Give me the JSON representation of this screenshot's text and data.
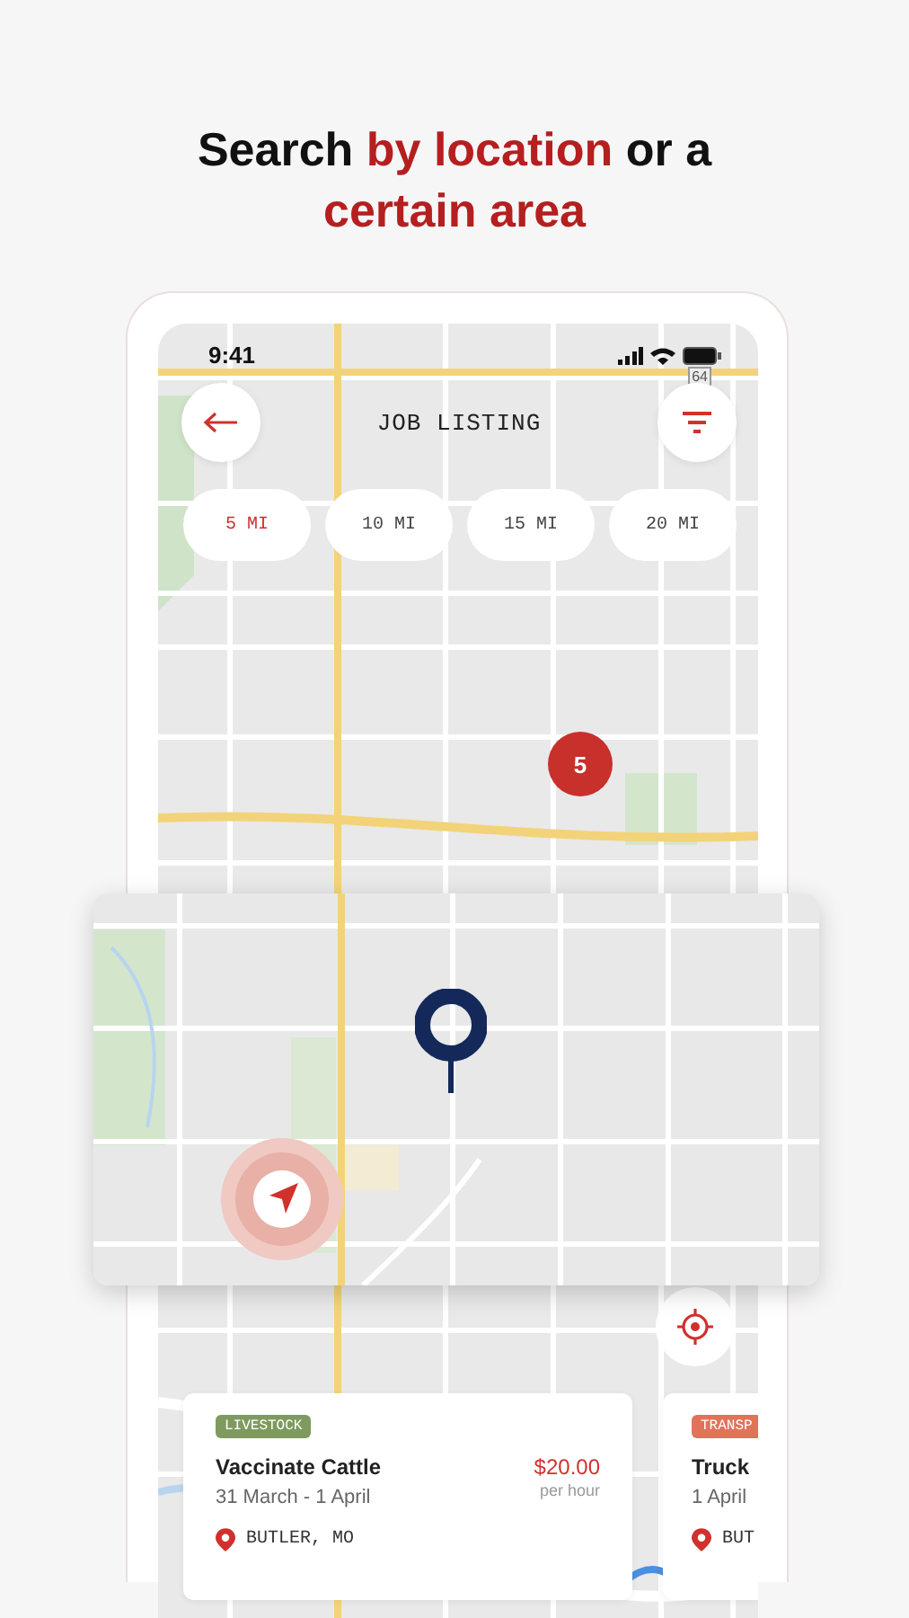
{
  "headline": {
    "lines": [
      [
        {
          "text": "Search ",
          "highlight": false
        },
        {
          "text": "by location",
          "highlight": true
        },
        {
          "text": " or a",
          "highlight": false
        }
      ],
      [
        {
          "text": "certain area",
          "highlight": true
        }
      ]
    ]
  },
  "status_bar": {
    "time": "9:41",
    "badge": "64"
  },
  "header": {
    "title": "JOB LISTING"
  },
  "distance_chips": [
    {
      "label": "5 MI",
      "selected": true
    },
    {
      "label": "10 MI",
      "selected": false
    },
    {
      "label": "15 MI",
      "selected": false
    },
    {
      "label": "20 MI",
      "selected": false
    }
  ],
  "cluster_count": "5",
  "job_cards": [
    {
      "tag": "LIVESTOCK",
      "color": "#7f9a5e",
      "title": "Vaccinate Cattle",
      "dates": "31 March - 1 April",
      "price": "$20.00",
      "price_unit": "per hour",
      "location": "BUTLER, MO"
    },
    {
      "tag": "TRANSP",
      "color": "#e0735a",
      "title": "Truck",
      "dates": "1 April",
      "location": "BUT"
    }
  ]
}
